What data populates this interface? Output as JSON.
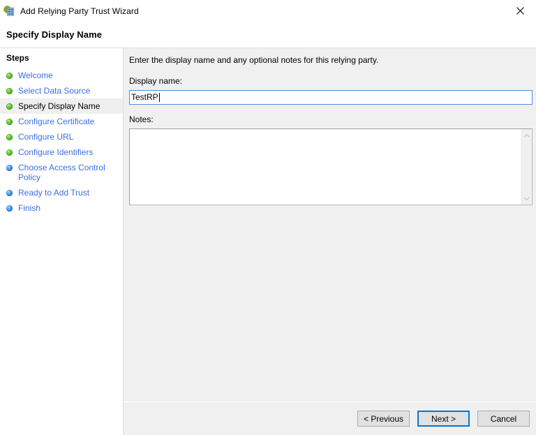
{
  "window": {
    "title": "Add Relying Party Trust Wizard",
    "icon": "relying-party-trust-icon",
    "close_icon": "close-icon"
  },
  "page": {
    "heading": "Specify Display Name"
  },
  "sidebar": {
    "title": "Steps",
    "items": [
      {
        "label": "Welcome",
        "state": "done",
        "current": false
      },
      {
        "label": "Select Data Source",
        "state": "done",
        "current": false
      },
      {
        "label": "Specify Display Name",
        "state": "done",
        "current": true
      },
      {
        "label": "Configure Certificate",
        "state": "done",
        "current": false
      },
      {
        "label": "Configure URL",
        "state": "done",
        "current": false
      },
      {
        "label": "Configure Identifiers",
        "state": "done",
        "current": false
      },
      {
        "label": "Choose Access Control Policy",
        "state": "todo",
        "current": false
      },
      {
        "label": "Ready to Add Trust",
        "state": "todo",
        "current": false
      },
      {
        "label": "Finish",
        "state": "todo",
        "current": false
      }
    ]
  },
  "main": {
    "intro": "Enter the display name and any optional notes for this relying party.",
    "display_name_label": "Display name:",
    "display_name_value": "TestRP",
    "display_name_placeholder": "",
    "notes_label": "Notes:",
    "notes_value": "",
    "notes_placeholder": "",
    "scroll_up_icon": "chevron-up-icon",
    "scroll_down_icon": "chevron-down-icon"
  },
  "buttons": {
    "previous": "< Previous",
    "next": "Next >",
    "cancel": "Cancel"
  },
  "colors": {
    "link": "#3b6fe3",
    "step_done": "#5cc42a",
    "step_todo": "#3f97ea",
    "focus_border": "#4a90d9",
    "default_button_border": "#0078d7",
    "content_bg": "#f0f0f0"
  }
}
